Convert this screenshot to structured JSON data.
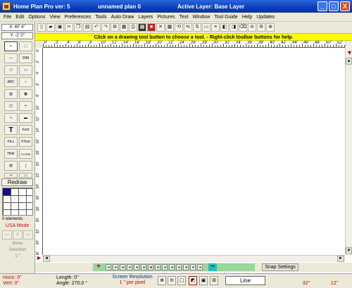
{
  "window": {
    "app_title": "Home Plan Pro ver: 5",
    "plan_name": "unnamed plan 0",
    "active_layer": "Active Layer: Base Layer",
    "minimize_label": "_",
    "maximize_label": "□",
    "close_label": "X"
  },
  "menu": {
    "items": [
      "File",
      "Edit",
      "Options",
      "View",
      "Preferences",
      "Tools",
      "Auto Draw",
      "Layers",
      "Pictures",
      "Text",
      "Window",
      "Tool Guide",
      "Help",
      "Updates"
    ]
  },
  "coords": {
    "x": "X: 40' 4\"",
    "y": "Y: -2' 0\""
  },
  "tools": {
    "dim_label": "DIM",
    "arc_label": "ARC",
    "text_label": "T",
    "font_label": "Font",
    "fill_label": "FILL",
    "ftext_label": "FText",
    "hide_label": "Hide",
    "clone_label": "CLONE",
    "redraw_label": "Redraw"
  },
  "left_panel": {
    "element_count": "0 elements",
    "mode": "USA Mode",
    "move_label": "Move",
    "selection_label": "Selection",
    "selection_value": "1 \""
  },
  "message": "Click on a drawing tool button to choose a tool.  -  Right-click toolbar buttons for help.",
  "ruler_h": [
    "0'",
    "2'",
    "4'",
    "6'",
    "8'",
    "10'",
    "12'",
    "14'",
    "16'",
    "18'",
    "20'",
    "22'",
    "24'",
    "26'",
    "28'",
    "30'",
    "32'",
    "34'",
    "36'",
    "38'",
    "40'",
    "42'",
    "44'",
    "46'",
    "48'",
    "50'",
    "52'",
    "54'"
  ],
  "ruler_v": [
    "0'",
    "2'",
    "4'",
    "6'",
    "8'",
    "10'",
    "12'",
    "14'",
    "16'",
    "18'",
    "20'",
    "22'",
    "24'",
    "26'",
    "28'",
    "30'",
    "32'",
    "34'",
    "36'",
    "38'"
  ],
  "layer_strip": {
    "add_label": "+",
    "remove_label": "−",
    "snap_label": "Snap Settings"
  },
  "status": {
    "horiz": "Horiz: 0\"",
    "vert": "Vert: 0\"",
    "length": "Length: 0\"",
    "angle": "Angle: 270.0 °",
    "resolution_label": "Screen Resolution",
    "resolution_value": "1 \" per pixel",
    "line_style": "Line",
    "val1": "32\"",
    "val2": "12\""
  },
  "colors": {
    "titlebar": "#0a3fb5",
    "message_bg": "#ffff00",
    "layer_strip": "#9ad79a",
    "accent_red": "#c00000"
  }
}
